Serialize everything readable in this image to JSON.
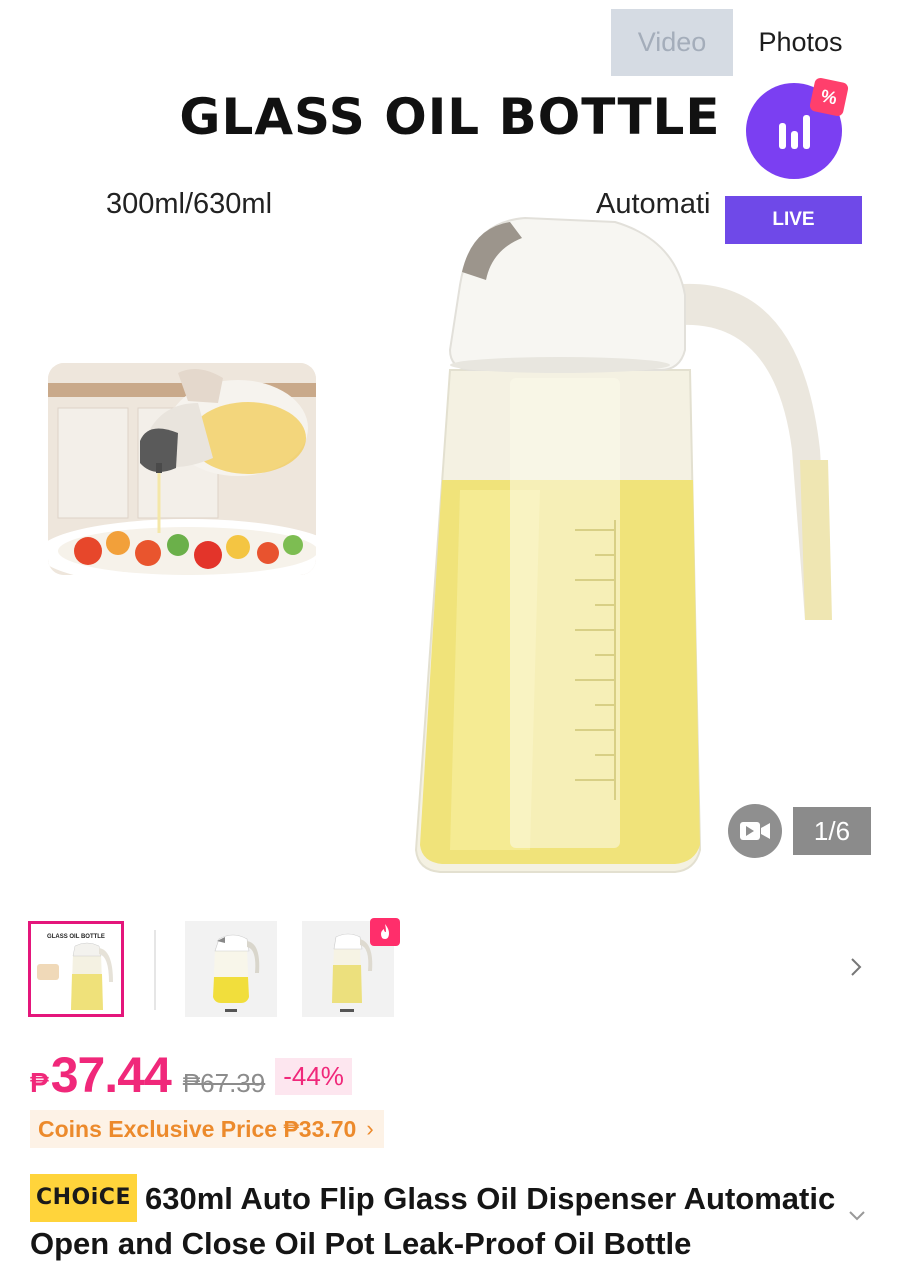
{
  "gallery": {
    "tabs": {
      "video_label": "Video",
      "photos_label": "Photos",
      "active": "Photos"
    },
    "banner": {
      "title": "GLASS OIL BOTTLE",
      "caption_left": "300ml/630ml",
      "caption_right": "Automati"
    },
    "live": {
      "badge_label": "LIVE",
      "coupon_symbol": "%"
    },
    "video_icon": "video-camera-icon",
    "counter": "1/6"
  },
  "thumbnails": {
    "items": [
      {
        "name": "thumb-1",
        "selected": true
      },
      {
        "name": "thumb-2",
        "selected": false
      },
      {
        "name": "thumb-3",
        "selected": false,
        "badge": "flame-icon"
      }
    ],
    "thumb1_title": "GLASS OIL BOTTLE",
    "next_icon": "chevron-right-icon"
  },
  "price": {
    "currency": "₱",
    "current": "37.44",
    "original": "₱67.39",
    "discount": "-44%"
  },
  "coins": {
    "label": "Coins Exclusive Price ₱33.70",
    "chevron": "›"
  },
  "product": {
    "choice_badge": "CHOiCE",
    "title": "630ml Auto Flip Glass Oil Dispenser Automatic Open and Close Oil Pot Leak-Proof Oil Bottle",
    "expand_icon": "chevron-down-icon"
  },
  "colors": {
    "accent": "#f0287a",
    "coins": "#ec8a2c",
    "live": "#6f49e8",
    "choice": "#ffd43b"
  }
}
